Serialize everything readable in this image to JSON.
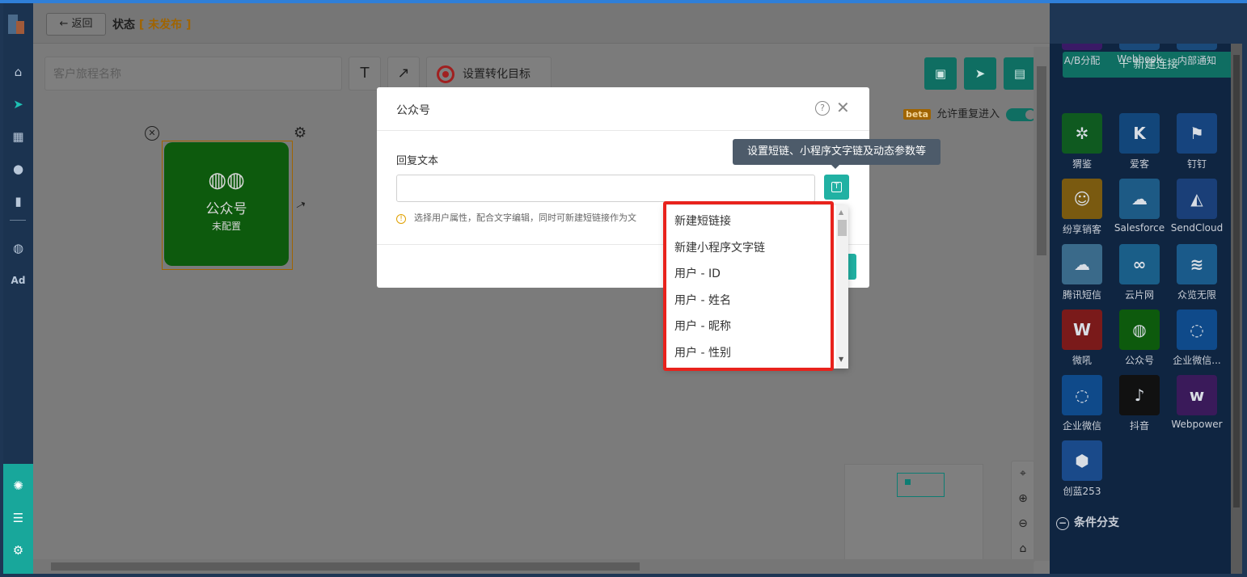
{
  "nav": {
    "items": [
      "home-icon",
      "send-icon",
      "layout-icon",
      "user-icon",
      "chart-icon",
      "wechat-icon",
      "ad-icon"
    ],
    "ad_label": "Ad",
    "bottom": [
      "settings-circle-icon",
      "storage-icon",
      "gear-icon"
    ]
  },
  "topbar": {
    "back_label": "← 返回",
    "status_label": "状态",
    "status_bracket_open": "[",
    "status_value": "未发布",
    "status_bracket_close": "]"
  },
  "toolbar": {
    "name_placeholder": "客户旅程名称",
    "text_tool": "T",
    "arrow_tool": "↗",
    "goal_label": "设置转化目标",
    "beta_tag": "beta",
    "repeat_label": "允许重复进入"
  },
  "node": {
    "title": "公众号",
    "subtitle": "未配置"
  },
  "modal": {
    "title": "公众号",
    "field_label": "回复文本",
    "text_value": "",
    "hint": "选择用户属性，配合文字编辑，同时可新建短链接作为文"
  },
  "tooltip": "设置短链、小程序文字链及动态参数等",
  "dropdown": {
    "options": [
      "新建短链接",
      "新建小程序文字链",
      "用户 - ID",
      "用户 - 姓名",
      "用户 - 昵称",
      "用户 - 性别"
    ]
  },
  "right_panel": {
    "new_connection": "新建连接",
    "tiles": [
      {
        "label": "A/B分配",
        "color": "#3a1a66"
      },
      {
        "label": "Webhook",
        "color": "#1a4a7a"
      },
      {
        "label": "内部通知",
        "color": "#1a4a7a"
      },
      {
        "label": "猬鉴",
        "color": "#0f5a20"
      },
      {
        "label": "爱客",
        "color": "#12467a"
      },
      {
        "label": "钉钉",
        "color": "#16447e"
      },
      {
        "label": "纷享销客",
        "color": "#7a5a10"
      },
      {
        "label": "Salesforce",
        "color": "#1d5a85"
      },
      {
        "label": "SendCloud",
        "color": "#1a3f78"
      },
      {
        "label": "腾讯短信",
        "color": "#3a6a8a"
      },
      {
        "label": "云片网",
        "color": "#1a5e88"
      },
      {
        "label": "众览无限",
        "color": "#1a5a8a"
      },
      {
        "label": "微吼",
        "color": "#7a1a1a"
      },
      {
        "label": "公众号",
        "color": "#0d5a0d"
      },
      {
        "label": "企业微信...",
        "color": "#0f4a8a"
      },
      {
        "label": "企业微信",
        "color": "#0f4a8a"
      },
      {
        "label": "抖音",
        "color": "#111111"
      },
      {
        "label": "Webpower",
        "color": "#3a1a5a"
      },
      {
        "label": "创蓝253",
        "color": "#1a4a8a"
      }
    ],
    "section_label": "条件分支"
  }
}
